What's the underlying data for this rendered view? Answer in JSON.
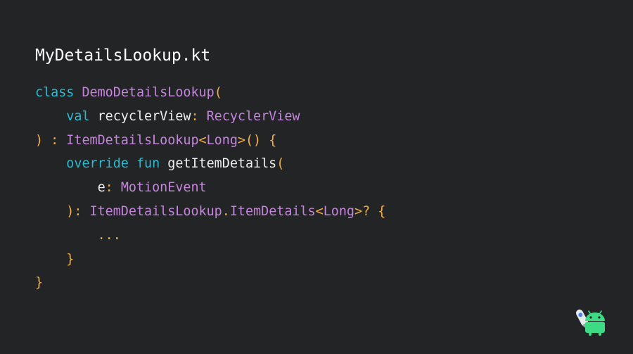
{
  "slide": {
    "title": "MyDetailsLookup.kt"
  },
  "code": {
    "lines": [
      {
        "indent": 0,
        "tokens": [
          {
            "t": "class",
            "k": "kw"
          },
          {
            "t": " ",
            "k": "id"
          },
          {
            "t": "DemoDetailsLookup",
            "k": "type"
          },
          {
            "t": "(",
            "k": "punct"
          }
        ]
      },
      {
        "indent": 1,
        "tokens": [
          {
            "t": "val",
            "k": "kw"
          },
          {
            "t": " recyclerView",
            "k": "id"
          },
          {
            "t": ": ",
            "k": "punct"
          },
          {
            "t": "RecyclerView",
            "k": "type"
          }
        ]
      },
      {
        "indent": 0,
        "tokens": [
          {
            "t": ") : ",
            "k": "punct"
          },
          {
            "t": "ItemDetailsLookup",
            "k": "type"
          },
          {
            "t": "<",
            "k": "punct"
          },
          {
            "t": "Long",
            "k": "type"
          },
          {
            "t": ">() {",
            "k": "punct"
          }
        ]
      },
      {
        "indent": 1,
        "tokens": [
          {
            "t": "override",
            "k": "kw"
          },
          {
            "t": " ",
            "k": "id"
          },
          {
            "t": "fun",
            "k": "kw"
          },
          {
            "t": " getItemDetails",
            "k": "id"
          },
          {
            "t": "(",
            "k": "punct"
          }
        ]
      },
      {
        "indent": 2,
        "tokens": [
          {
            "t": "e",
            "k": "id"
          },
          {
            "t": ": ",
            "k": "punct"
          },
          {
            "t": "MotionEvent",
            "k": "type"
          }
        ]
      },
      {
        "indent": 1,
        "tokens": [
          {
            "t": "): ",
            "k": "punct"
          },
          {
            "t": "ItemDetailsLookup",
            "k": "type"
          },
          {
            "t": ".",
            "k": "punct"
          },
          {
            "t": "ItemDetails",
            "k": "type"
          },
          {
            "t": "<",
            "k": "punct"
          },
          {
            "t": "Long",
            "k": "type"
          },
          {
            "t": ">? {",
            "k": "punct"
          }
        ]
      },
      {
        "indent": 2,
        "tokens": [
          {
            "t": "...",
            "k": "dots"
          }
        ]
      },
      {
        "indent": 1,
        "tokens": [
          {
            "t": "}",
            "k": "punct"
          }
        ]
      },
      {
        "indent": 0,
        "tokens": [
          {
            "t": "}",
            "k": "punct"
          }
        ]
      }
    ]
  },
  "colors": {
    "background": "#232425",
    "keyword": "#2bbbd2",
    "type": "#c585de",
    "punctuation": "#f4b04a",
    "identifier": "#f0f0f0",
    "title": "#ffffff"
  },
  "logo": {
    "icon": "android-studio-icon"
  }
}
